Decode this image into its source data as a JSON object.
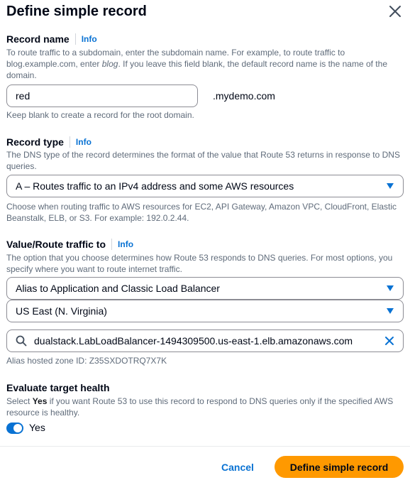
{
  "dialog": {
    "title": "Define simple record",
    "close_icon": "close-icon"
  },
  "record_name": {
    "label": "Record name",
    "info": "Info",
    "desc_part1": "To route traffic to a subdomain, enter the subdomain name. For example, to route traffic to blog.example.com, enter ",
    "desc_em": "blog",
    "desc_part2": ". If you leave this field blank, the default record name is the name of the domain.",
    "value": "red",
    "suffix": ".mydemo.com",
    "hint": "Keep blank to create a record for the root domain."
  },
  "record_type": {
    "label": "Record type",
    "info": "Info",
    "desc": "The DNS type of the record determines the format of the value that Route 53 returns in response to DNS queries.",
    "selected": "A – Routes traffic to an IPv4 address and some AWS resources",
    "hint": "Choose when routing traffic to AWS resources for EC2, API Gateway, Amazon VPC, CloudFront, Elastic Beanstalk, ELB, or S3. For example: 192.0.2.44."
  },
  "route_traffic": {
    "label": "Value/Route traffic to",
    "info": "Info",
    "desc": "The option that you choose determines how Route 53 responds to DNS queries. For most options, you specify where you want to route internet traffic.",
    "endpoint_selected": "Alias to Application and Classic Load Balancer",
    "region_selected": "US East (N. Virginia)",
    "search_value": "dualstack.LabLoadBalancer-1494309500.us-east-1.elb.amazonaws.com",
    "zone_hint": "Alias hosted zone ID: Z35SXDOTRQ7X7K"
  },
  "evaluate_health": {
    "label": "Evaluate target health",
    "desc_part1": "Select ",
    "desc_bold": "Yes",
    "desc_part2": " if you want Route 53 to use this record to respond to DNS queries only if the specified AWS resource is healthy.",
    "toggle_on": true,
    "toggle_label": "Yes"
  },
  "footer": {
    "cancel_label": "Cancel",
    "primary_label": "Define simple record"
  },
  "colors": {
    "accent": "#0972d3",
    "primary_button": "#ff9900"
  }
}
